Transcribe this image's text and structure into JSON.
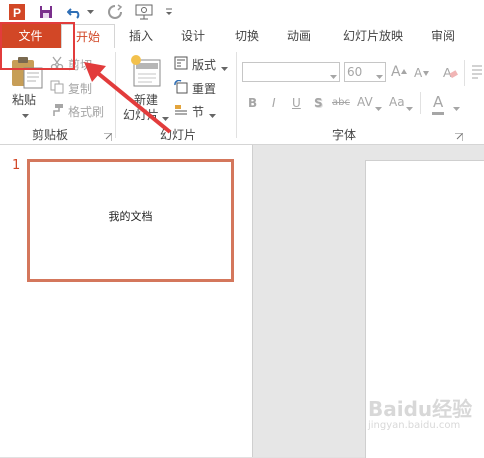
{
  "qat": {
    "app_icon_letter": "P",
    "icons": [
      "powerpoint-app-icon",
      "save-icon",
      "undo-icon",
      "undo-dropdown-icon",
      "redo-icon",
      "start-from-beginning-icon",
      "customize-qat-icon"
    ]
  },
  "tabs": [
    {
      "label": "文件"
    },
    {
      "label": "开始"
    },
    {
      "label": "插入"
    },
    {
      "label": "设计"
    },
    {
      "label": "切换"
    },
    {
      "label": "动画"
    },
    {
      "label": "幻灯片放映"
    },
    {
      "label": "审阅"
    }
  ],
  "ribbon": {
    "clipboard": {
      "paste_label": "粘贴",
      "cut_label": "剪切",
      "copy_label": "复制",
      "format_painter_label": "格式刷",
      "group_label": "剪贴板"
    },
    "slides": {
      "new_slide_line1": "新建",
      "new_slide_line2": "幻灯片",
      "layout_label": "版式",
      "reset_label": "重置",
      "section_label": "节",
      "group_label": "幻灯片"
    },
    "font": {
      "font_name": "",
      "font_size": "60",
      "group_label": "字体",
      "grow_label": "A",
      "shrink_label": "A",
      "clear_label": "A",
      "bold": "B",
      "italic": "I",
      "underline": "U",
      "shadow": "S",
      "strike": "abc",
      "spacing": "AV",
      "case": "Aa",
      "color": "A"
    }
  },
  "thumbnail": {
    "number": "1",
    "text": "我的文档"
  },
  "watermark": {
    "line1": "Baidu经验",
    "line2": "jingyan.baidu.com"
  },
  "colors": {
    "accent": "#d24726",
    "annotation": "#e23c3c",
    "thumb_border": "#d4775c"
  }
}
